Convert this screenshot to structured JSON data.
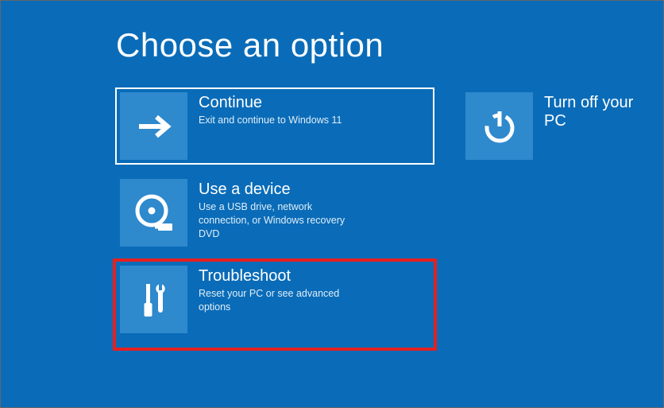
{
  "page": {
    "title": "Choose an option"
  },
  "options": {
    "continue": {
      "label": "Continue",
      "desc": "Exit and continue to Windows 11"
    },
    "use_device": {
      "label": "Use a device",
      "desc": "Use a USB drive, network connection, or Windows recovery DVD"
    },
    "troubleshoot": {
      "label": "Troubleshoot",
      "desc": "Reset your PC or see advanced options"
    },
    "turn_off": {
      "label": "Turn off your PC"
    }
  },
  "colors": {
    "background": "#0a6cb8",
    "tile_icon_bg": "#2e89cd",
    "highlight": "#e52020"
  }
}
